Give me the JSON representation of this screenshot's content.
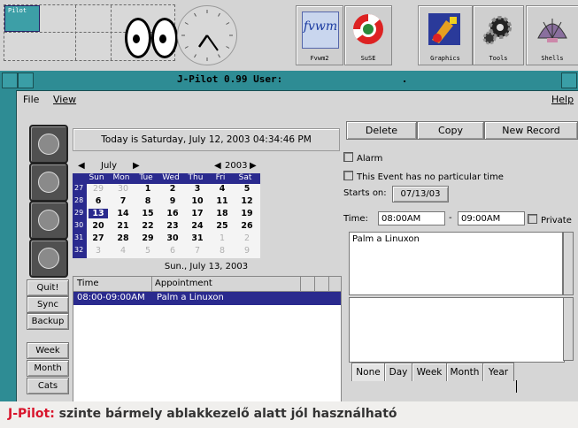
{
  "panel": {
    "pager_label": "Pilot",
    "buttons": [
      {
        "label": "Fvwm2",
        "icon": "fvwm-logo-icon",
        "logo_text": "fvwm"
      },
      {
        "label": "SuSE",
        "icon": "lifebuoy-icon"
      },
      {
        "label": "Graphics",
        "icon": "paint-brush-icon"
      },
      {
        "label": "Tools",
        "icon": "gears-icon"
      },
      {
        "label": "Shells",
        "icon": "shell-icon"
      }
    ]
  },
  "window": {
    "title": "J-Pilot 0.99 User:",
    "title_dot": ".",
    "menu": {
      "file": "File",
      "view": "View",
      "help": "Help"
    }
  },
  "today_text": "Today is Saturday, July 12, 2003 04:34:46 PM",
  "calendar": {
    "month": "July",
    "year": "2003",
    "weekdays": [
      "Sun",
      "Mon",
      "Tue",
      "Wed",
      "Thu",
      "Fri",
      "Sat"
    ],
    "week_numbers": [
      "27",
      "28",
      "29",
      "30",
      "31",
      "32"
    ],
    "weeks": [
      [
        "29",
        "30",
        "1",
        "2",
        "3",
        "4",
        "5"
      ],
      [
        "6",
        "7",
        "8",
        "9",
        "10",
        "11",
        "12"
      ],
      [
        "13",
        "14",
        "15",
        "16",
        "17",
        "18",
        "19"
      ],
      [
        "20",
        "21",
        "22",
        "23",
        "24",
        "25",
        "26"
      ],
      [
        "27",
        "28",
        "29",
        "30",
        "31",
        "1",
        "2"
      ],
      [
        "3",
        "4",
        "5",
        "6",
        "7",
        "8",
        "9"
      ]
    ],
    "selected": "13",
    "selected_date_text": "Sun., July 13, 2003"
  },
  "appointments": {
    "headers": {
      "time": "Time",
      "appointment": "Appointment"
    },
    "rows": [
      {
        "time": "08:00-09:00AM",
        "text": "Palm a Linuxon"
      }
    ]
  },
  "left_buttons": {
    "quit": "Quit!",
    "sync": "Sync",
    "backup": "Backup",
    "week": "Week",
    "month": "Month",
    "cats": "Cats"
  },
  "editor": {
    "delete": "Delete",
    "copy": "Copy",
    "new_record": "New Record",
    "alarm": "Alarm",
    "no_time": "This Event has no particular time",
    "starts_on_label": "Starts on:",
    "starts_on": "07/13/03",
    "time_label": "Time:",
    "time_from": "08:00AM",
    "time_sep": "-",
    "time_to": "09:00AM",
    "private": "Private",
    "description": "Palm a Linuxon",
    "repeat_tabs": [
      "None",
      "Day",
      "Week",
      "Month",
      "Year"
    ]
  },
  "caption": {
    "app": "J-Pilot:",
    "text": " szinte bármely ablakkezelő alatt jól használható"
  },
  "colors": {
    "title_bar": "#2e8c94",
    "selection": "#2a2a8e",
    "caption_accent": "#d8142b"
  }
}
